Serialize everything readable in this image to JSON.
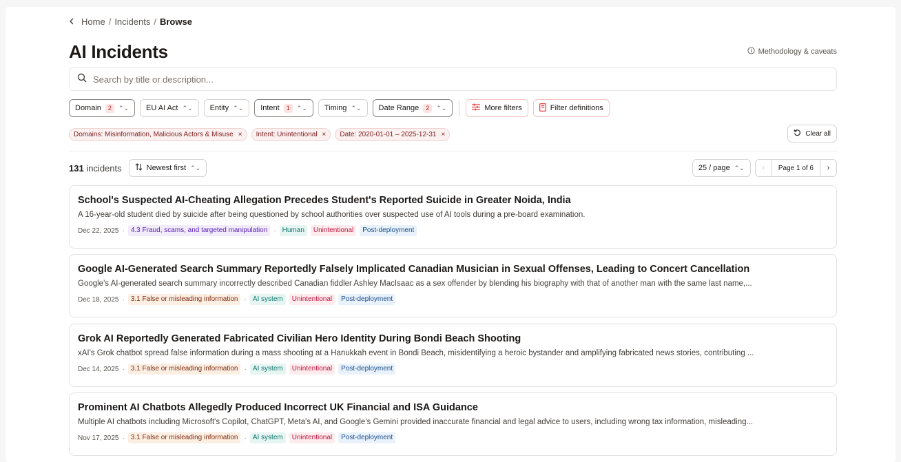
{
  "breadcrumb": {
    "home": "Home",
    "sep1": "/",
    "incidents": "Incidents",
    "sep2": "/",
    "current": "Browse"
  },
  "page_title": "AI Incidents",
  "methodology_link": "Methodology & caveats",
  "search": {
    "placeholder": "Search by title or description...",
    "value": ""
  },
  "filters": [
    {
      "label": "Domain",
      "count": "2",
      "active": true
    },
    {
      "label": "EU AI Act",
      "count": null,
      "active": false
    },
    {
      "label": "Entity",
      "count": null,
      "active": false
    },
    {
      "label": "Intent",
      "count": "1",
      "active": true
    },
    {
      "label": "Timing",
      "count": null,
      "active": false
    },
    {
      "label": "Date Range",
      "count": "2",
      "active": true
    }
  ],
  "more_filters": "More filters",
  "filter_definitions": "Filter definitions",
  "active_chips": [
    "Domains: Misinformation, Malicious Actors & Misuse",
    "Intent: Unintentional",
    "Date: 2020-01-01 – 2025-12-31"
  ],
  "chip_remove": "×",
  "clear_all": "Clear all",
  "results": {
    "count": "131",
    "count_label": " incidents",
    "sort_label": "Newest first",
    "per_page": "25 / page",
    "page_label": "Page 1 of 6",
    "prev": "‹",
    "next": "›"
  },
  "meta_dot": "·",
  "incidents": [
    {
      "title": "School's Suspected AI-Cheating Allegation Precedes Student's Reported Suicide in Greater Noida, India",
      "description": "A 16-year-old student died by suicide after being questioned by school authorities over suspected use of AI tools during a pre-board examination.",
      "date": "Dec 22, 2025",
      "category": "4.3 Fraud, scams, and targeted manipulation",
      "entity": "Human",
      "intent": "Unintentional",
      "timing": "Post-deployment"
    },
    {
      "title": "Google AI-Generated Search Summary Reportedly Falsely Implicated Canadian Musician in Sexual Offenses, Leading to Concert Cancellation",
      "description": "Google's AI-generated search summary incorrectly described Canadian fiddler Ashley MacIsaac as a sex offender by blending his biography with that of another man with the same last name,...",
      "date": "Dec 18, 2025",
      "category": "3.1 False or misleading information",
      "entity": "AI system",
      "intent": "Unintentional",
      "timing": "Post-deployment"
    },
    {
      "title": "Grok AI Reportedly Generated Fabricated Civilian Hero Identity During Bondi Beach Shooting",
      "description": "xAI's Grok chatbot spread false information during a mass shooting at a Hanukkah event in Bondi Beach, misidentifying a heroic bystander and amplifying fabricated news stories, contributing ...",
      "date": "Dec 14, 2025",
      "category": "3.1 False or misleading information",
      "entity": "AI system",
      "intent": "Unintentional",
      "timing": "Post-deployment"
    },
    {
      "title": "Prominent AI Chatbots Allegedly Produced Incorrect UK Financial and ISA Guidance",
      "description": "Multiple AI chatbots including Microsoft's Copilot, ChatGPT, Meta's AI, and Google's Gemini provided inaccurate financial and legal advice to users, including wrong tax information, misleading...",
      "date": "Nov 17, 2025",
      "category": "3.1 False or misleading information",
      "entity": "AI system",
      "intent": "Unintentional",
      "timing": "Post-deployment"
    }
  ]
}
